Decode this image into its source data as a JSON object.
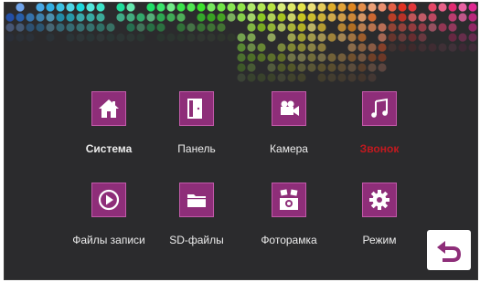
{
  "menu": {
    "items": [
      {
        "label": "Система",
        "icon": "home-icon"
      },
      {
        "label": "Панель",
        "icon": "door-icon"
      },
      {
        "label": "Камера",
        "icon": "video-camera-icon"
      },
      {
        "label": "Звонок",
        "icon": "music-note-icon"
      },
      {
        "label": "Файлы записи",
        "icon": "play-icon"
      },
      {
        "label": "SD-файлы",
        "icon": "folder-icon"
      },
      {
        "label": "Фоторамка",
        "icon": "photo-frame-icon"
      },
      {
        "label": "Режим",
        "icon": "gear-icon"
      }
    ],
    "selected": "Система",
    "highlighted": "Звонок"
  },
  "back_button": {
    "icon": "back-arrow-icon"
  },
  "colors": {
    "background": "#2b2b2d",
    "icon_tile": "#8e2e79",
    "highlight_text": "#c2191f",
    "text": "#ececec"
  }
}
